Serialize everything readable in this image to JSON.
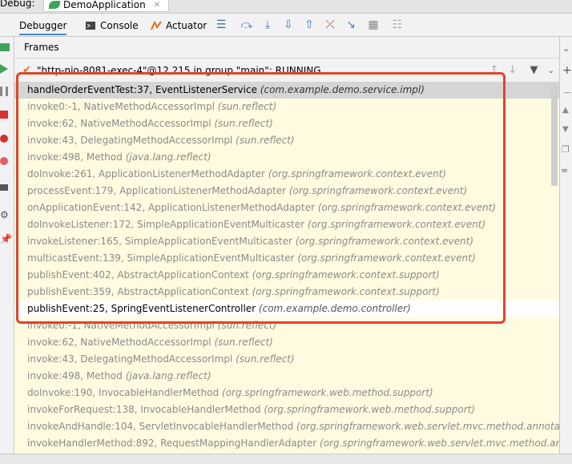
{
  "title_bar": {
    "debug_label": "Debug:",
    "tab_label": "DemoApplication"
  },
  "toolbar": {
    "debugger_label": "Debugger",
    "console_label": "Console",
    "actuator_label": "Actuator"
  },
  "frames_panel": {
    "header": "Frames",
    "thread": "\"http-nio-8081-exec-4\"@12,215 in group \"main\": RUNNING",
    "frames": [
      {
        "method": "handleOrderEventTest:37, EventListenerService",
        "pkg": "(com.example.demo.service.impl)",
        "kind": "selected"
      },
      {
        "method": "invoke0:-1, NativeMethodAccessorImpl",
        "pkg": "(sun.reflect)",
        "kind": "lib"
      },
      {
        "method": "invoke:62, NativeMethodAccessorImpl",
        "pkg": "(sun.reflect)",
        "kind": "lib"
      },
      {
        "method": "invoke:43, DelegatingMethodAccessorImpl",
        "pkg": "(sun.reflect)",
        "kind": "lib"
      },
      {
        "method": "invoke:498, Method",
        "pkg": "(java.lang.reflect)",
        "kind": "lib"
      },
      {
        "method": "doInvoke:261, ApplicationListenerMethodAdapter",
        "pkg": "(org.springframework.context.event)",
        "kind": "lib"
      },
      {
        "method": "processEvent:179, ApplicationListenerMethodAdapter",
        "pkg": "(org.springframework.context.event)",
        "kind": "lib"
      },
      {
        "method": "onApplicationEvent:142, ApplicationListenerMethodAdapter",
        "pkg": "(org.springframework.context.event)",
        "kind": "lib"
      },
      {
        "method": "doInvokeListener:172, SimpleApplicationEventMulticaster",
        "pkg": "(org.springframework.context.event)",
        "kind": "lib"
      },
      {
        "method": "invokeListener:165, SimpleApplicationEventMulticaster",
        "pkg": "(org.springframework.context.event)",
        "kind": "lib"
      },
      {
        "method": "multicastEvent:139, SimpleApplicationEventMulticaster",
        "pkg": "(org.springframework.context.event)",
        "kind": "lib"
      },
      {
        "method": "publishEvent:402, AbstractApplicationContext",
        "pkg": "(org.springframework.context.support)",
        "kind": "lib"
      },
      {
        "method": "publishEvent:359, AbstractApplicationContext",
        "pkg": "(org.springframework.context.support)",
        "kind": "lib"
      },
      {
        "method": "publishEvent:25, SpringEventListenerController",
        "pkg": "(com.example.demo.controller)",
        "kind": "user"
      },
      {
        "method": "invoke0:-1, NativeMethodAccessorImpl",
        "pkg": "(sun.reflect)",
        "kind": "lib"
      },
      {
        "method": "invoke:62, NativeMethodAccessorImpl",
        "pkg": "(sun.reflect)",
        "kind": "lib"
      },
      {
        "method": "invoke:43, DelegatingMethodAccessorImpl",
        "pkg": "(sun.reflect)",
        "kind": "lib"
      },
      {
        "method": "invoke:498, Method",
        "pkg": "(java.lang.reflect)",
        "kind": "lib"
      },
      {
        "method": "doInvoke:190, InvocableHandlerMethod",
        "pkg": "(org.springframework.web.method.support)",
        "kind": "lib"
      },
      {
        "method": "invokeForRequest:138, InvocableHandlerMethod",
        "pkg": "(org.springframework.web.method.support)",
        "kind": "lib"
      },
      {
        "method": "invokeAndHandle:104, ServletInvocableHandlerMethod",
        "pkg": "(org.springframework.web.servlet.mvc.method.annotation)",
        "kind": "lib"
      },
      {
        "method": "invokeHandlerMethod:892, RequestMappingHandlerAdapter",
        "pkg": "(org.springframework.web.servlet.mvc.method.annotation)",
        "kind": "lib"
      }
    ]
  },
  "colors": {
    "highlight_border": "#e0442c",
    "frames_background": "#fffbe0",
    "selected_row": "#d5d5d5"
  }
}
